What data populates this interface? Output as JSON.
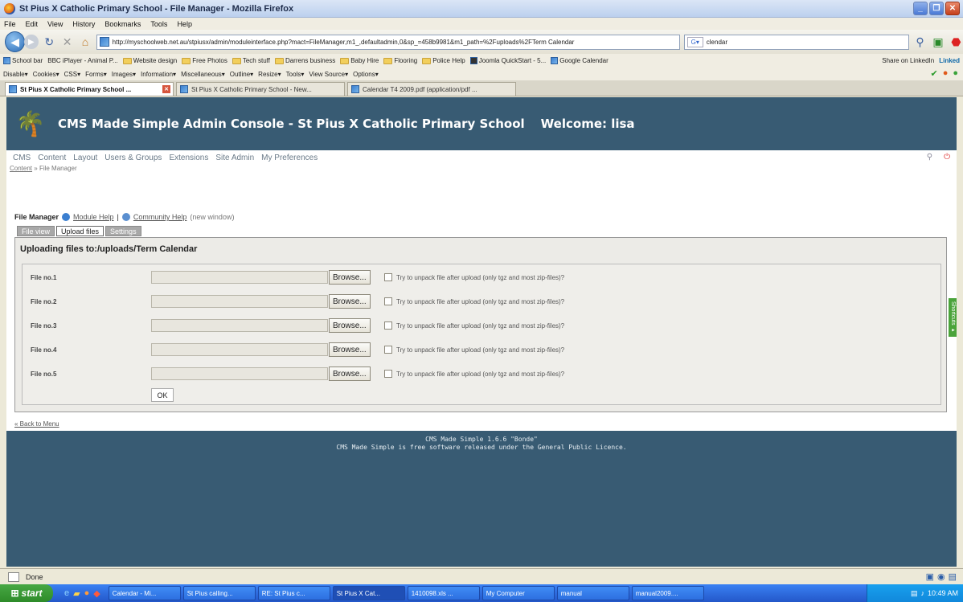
{
  "window": {
    "title": "St Pius X Catholic Primary School - File Manager - Mozilla Firefox"
  },
  "menubar": [
    "File",
    "Edit",
    "View",
    "History",
    "Bookmarks",
    "Tools",
    "Help"
  ],
  "navbar": {
    "url": "http://myschoolweb.net.au/stpiusx/admin/moduleinterface.php?mact=FileManager,m1_,defaultadmin,0&sp_=458b9981&m1_path=%2Fuploads%2FTerm Calendar",
    "search_value": "clendar"
  },
  "bookmarks": {
    "items": [
      "School bar",
      "BBC iPlayer - Animal P...",
      "Website design",
      "Free Photos",
      "Tech stuff",
      "Darrens business",
      "Baby Hire",
      "Flooring",
      "Police Help",
      "Joomla QuickStart - 5...",
      "Google Calendar"
    ],
    "right": [
      "Share on LinkedIn",
      "Linked"
    ]
  },
  "devbar": [
    "Disable▾",
    "Cookies▾",
    "CSS▾",
    "Forms▾",
    "Images▾",
    "Information▾",
    "Miscellaneous▾",
    "Outline▾",
    "Resize▾",
    "Tools▾",
    "View Source▾",
    "Options▾"
  ],
  "tabs": [
    {
      "label": "St Pius X Catholic Primary School ...",
      "active": true
    },
    {
      "label": "St Pius X Catholic Primary School - New...",
      "active": false
    },
    {
      "label": "Calendar T4 2009.pdf (application/pdf ...",
      "active": false
    }
  ],
  "cms": {
    "title": "CMS Made Simple Admin Console - St Pius X Catholic Primary School",
    "welcome": "Welcome: lisa",
    "menu": [
      "CMS",
      "Content",
      "Layout",
      "Users & Groups",
      "Extensions",
      "Site Admin",
      "My Preferences"
    ],
    "breadcrumb_link": "Content",
    "breadcrumb_sep": " » ",
    "breadcrumb_current": "File Manager",
    "module_title": "File Manager",
    "module_help": "Module Help",
    "separator": "|",
    "community_help": "Community Help",
    "new_window": "(new window)",
    "fm_tabs": [
      {
        "label": "File view",
        "active": false
      },
      {
        "label": "Upload files",
        "active": true
      },
      {
        "label": "Settings",
        "active": false
      }
    ],
    "upload_title": "Uploading files to:/uploads/Term Calendar",
    "files": [
      {
        "label": "File no.1"
      },
      {
        "label": "File no.2"
      },
      {
        "label": "File no.3"
      },
      {
        "label": "File no.4"
      },
      {
        "label": "File no.5"
      }
    ],
    "browse_label": "Browse...",
    "unpack_label": "Try to unpack file after upload (only tgz and most zip-files)?",
    "ok_label": "OK",
    "back_to_menu": "« Back to Menu",
    "footer_line1": "CMS Made Simple 1.6.6 \"Bonde\"",
    "footer_line2": "CMS Made Simple is free software released under the General Public Licence.",
    "shortcuts_label": "Shortcuts ▸"
  },
  "status": {
    "text": "Done"
  },
  "taskbar": {
    "start": "start",
    "tasks": [
      "Calendar - Mi...",
      "St Pius calling...",
      "RE: St Pius c...",
      "St Pius X Cat...",
      "1410098.xls ...",
      "My Computer",
      "manual",
      "manual2009...."
    ],
    "active_index": 3,
    "clock": "10:49 AM"
  }
}
